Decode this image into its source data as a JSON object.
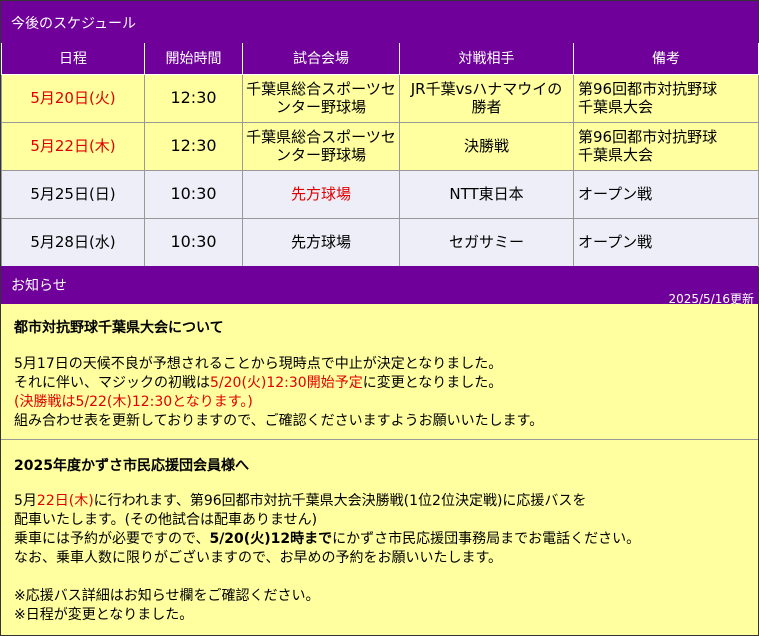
{
  "schedule": {
    "header": "今後のスケジュール",
    "columns": [
      "日程",
      "開始時間",
      "試合会場",
      "対戦相手",
      "備考"
    ],
    "rows": [
      {
        "date": "5月20日(火)",
        "time": "12:30",
        "venue_l1": "千葉県総合スポーツセ",
        "venue_l2": "ンター野球場",
        "opponent_l1": "JR千葉vsハナマウイの",
        "opponent_l2": "勝者",
        "note_l1": "第96回都市対抗野球",
        "note_l2": "千葉県大会"
      },
      {
        "date": "5月22日(木)",
        "time": "12:30",
        "venue_l1": "千葉県総合スポーツセ",
        "venue_l2": "ンター野球場",
        "opponent": "決勝戦",
        "note_l1": "第96回都市対抗野球",
        "note_l2": "千葉県大会"
      },
      {
        "date": "5月25日(日)",
        "time": "10:30",
        "venue": "先方球場",
        "opponent": "NTT東日本",
        "note": "オープン戦"
      },
      {
        "date": "5月28日(水)",
        "time": "10:30",
        "venue": "先方球場",
        "opponent": "セガサミー",
        "note": "オープン戦"
      }
    ]
  },
  "news": {
    "header": "お知らせ",
    "updated": "2025/5/16更新",
    "notice1": {
      "title": "都市対抗野球千葉県大会について",
      "l1": "5月17日の天候不良が予想されることから現時点で中止が決定となりました。",
      "l2a": "それに伴い、マジックの初戦は",
      "l2b": "5/20(火)12:30開始予定",
      "l2c": "に変更となりました。",
      "l3a": "(",
      "l3b": "決勝戦は5/22(木)12:30となります。",
      "l3c": ")",
      "l4": "組み合わせ表を更新しておりますので、ご確認くださいますようお願いいたします。"
    },
    "notice2": {
      "title": "2025年度かずさ市民応援団会員様へ",
      "l1a": "5月",
      "l1b": "22日(木)",
      "l1c": "に行われます、第96回都市対抗千葉県大会決勝戦(1位2位決定戦)に応援バスを",
      "l2": "配車いたします。(その他試合は配車ありません)",
      "l3a": "乗車には予約が必要ですので、",
      "l3b": "5/20(火)12時まで",
      "l3c": "にかずさ市民応援団事務局までお電話ください。",
      "l4": "なお、乗車人数に限りがございますので、お早めの予約をお願いいたします。",
      "l5": "※応援バス詳細はお知らせ欄をご確認ください。",
      "l6": "※日程が変更となりました。"
    }
  },
  "colors": {
    "header_purple": "#6f0099",
    "row_yellow": "#ffffa0",
    "row_lavender": "#eeeef8",
    "highlight_red": "#e00000"
  }
}
